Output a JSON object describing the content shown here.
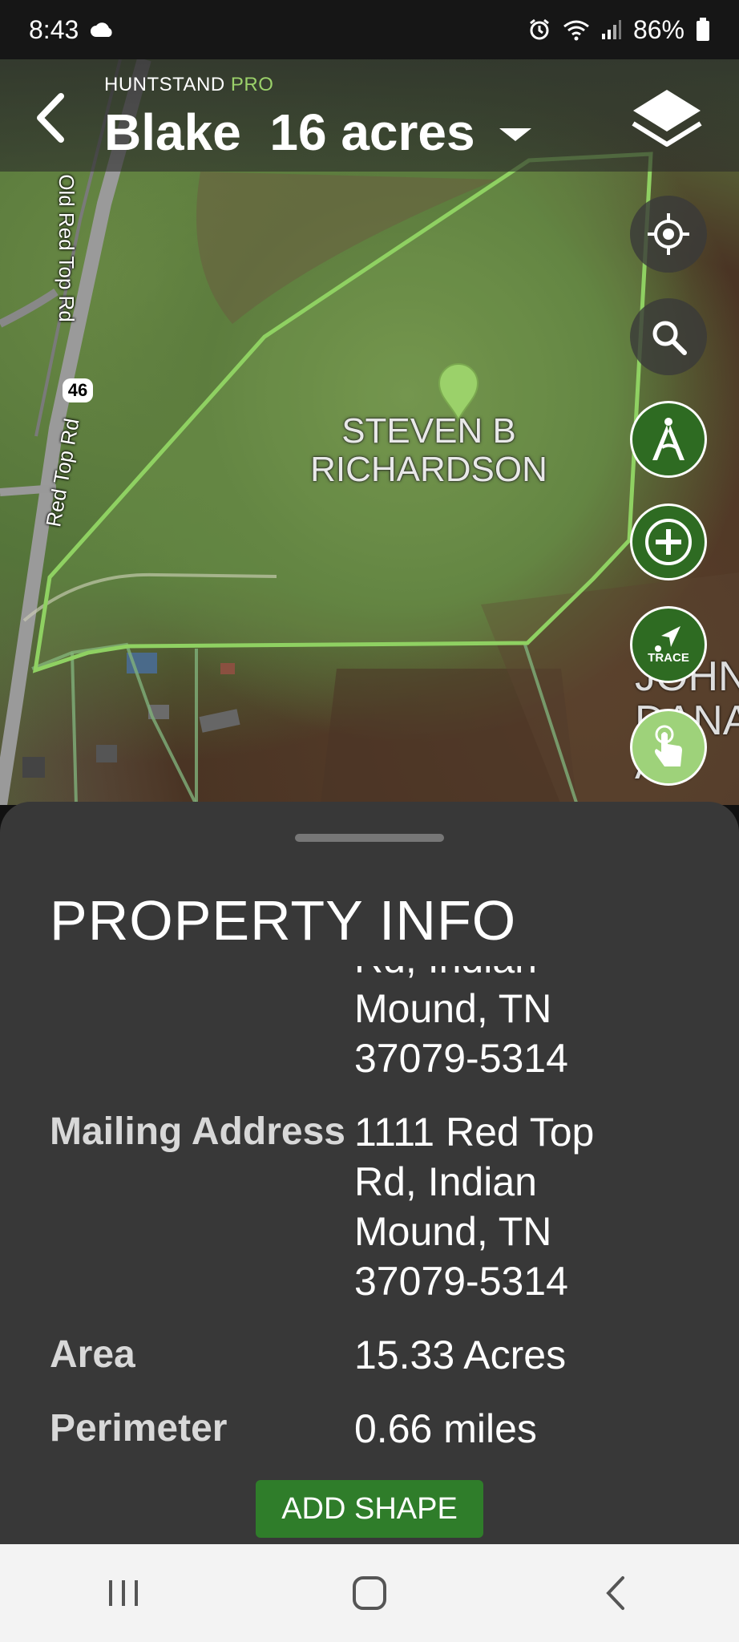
{
  "status_bar": {
    "time": "8:43",
    "battery": "86%",
    "icons": [
      "cloud-icon",
      "alarm-icon",
      "wifi-icon",
      "signal-icon",
      "battery-icon"
    ]
  },
  "header": {
    "brand": "HUNTSTAND",
    "brand_pro": "PRO",
    "title": "Blake  16 acres",
    "icons": [
      "back-arrow-icon",
      "chevron-down-icon",
      "layers-icon"
    ]
  },
  "map": {
    "road_labels": [
      "Old Red Top Rd",
      "Red Top Rd"
    ],
    "route_shield": "46",
    "owner_label_line1": "STEVEN B",
    "owner_label_line2": "RICHARDSON",
    "side_label_lines": [
      "JOHN",
      "DANA",
      "AN"
    ],
    "boundary_color": "#8fd162",
    "buttons": [
      {
        "icon": "crosshair-location-icon"
      },
      {
        "icon": "search-icon"
      },
      {
        "icon": "compass-measure-icon"
      },
      {
        "icon": "plus-icon"
      },
      {
        "icon": "trace-arrow-icon",
        "label": "TRACE"
      },
      {
        "icon": "tap-hand-icon"
      }
    ]
  },
  "sheet": {
    "title": "PROPERTY INFO",
    "partial_address": [
      "Rd, Indian",
      "Mound, TN",
      "37079-5314"
    ],
    "rows": [
      {
        "key": "Mailing Address",
        "value_lines": [
          "1111 Red Top",
          "Rd, Indian",
          "Mound, TN",
          "37079-5314"
        ]
      },
      {
        "key": "Area",
        "value_lines": [
          "15.33 Acres"
        ]
      },
      {
        "key": "Perimeter",
        "value_lines": [
          "0.66 miles"
        ]
      }
    ],
    "add_shape_label": "ADD SHAPE"
  },
  "nav": {
    "icons": [
      "recent-apps-icon",
      "home-icon",
      "back-icon"
    ]
  },
  "colors": {
    "accent_green": "#2f7d2a",
    "pro_green": "#9bd16a",
    "sheet_bg": "#383838"
  }
}
